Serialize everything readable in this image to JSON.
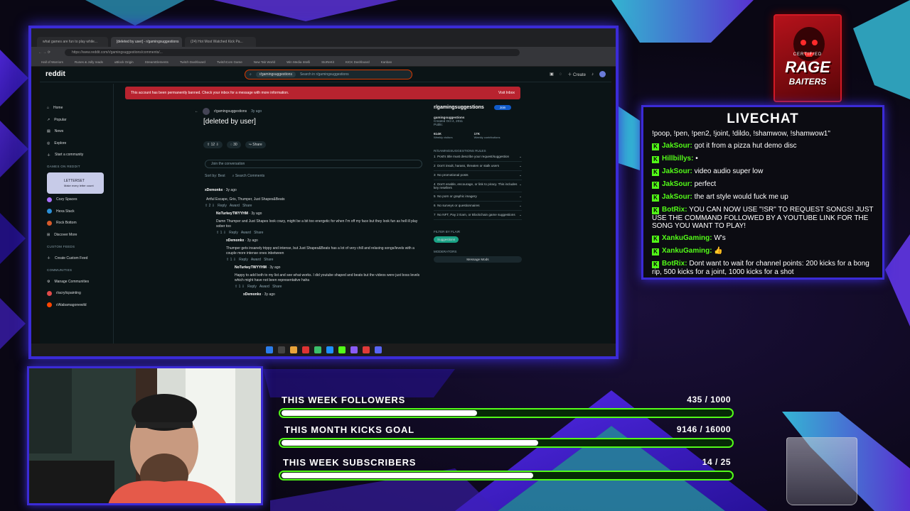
{
  "browser": {
    "tabs": [
      "what games are fun to play while...",
      "[deleted by user] - r/gamingsuggestions",
      "(24) Hot Most Watched Kick Pa..."
    ],
    "url": "https://www.reddit.com/r/gamingsuggestions/comments/...",
    "bookmarks": [
      "Hall of Warriors",
      "Runes & Jolly reads",
      "uBlock Origin",
      "StreamElements",
      "Twitch Dashboard",
      "TwitchCom Game",
      "New Tab World",
      "Win Media Intelli",
      "StoReKit",
      "KICK Dashboard",
      "Kanban"
    ]
  },
  "reddit": {
    "logo": "reddit",
    "search_chip": "r/gamingsuggestions",
    "search_placeholder": "Search in r/gamingsuggestions",
    "create_label": "Create",
    "ban_text": "This account has been permanently banned. Check your inbox for a message with more information.",
    "ban_action": "Visit Inbox",
    "nav": {
      "home": "Home",
      "popular": "Popular",
      "news": "News",
      "explore": "Explore",
      "start_community": "Start a community",
      "games_header": "GAMES ON REDDIT",
      "game_card_title": "LETTERSET",
      "game_card_sub": "Make every letter count",
      "games": [
        "Cozy Spaces",
        "Hexa Stack",
        "Rock Bottom"
      ],
      "discover": "Discover More",
      "custom_header": "CUSTOM FEEDS",
      "custom_feed": "Create Custom Feed",
      "communities_header": "COMMUNITIES",
      "manage": "Manage Communities",
      "comm1": "r/acrylicpainting",
      "comm2": "r/Alabamagonewild"
    },
    "post": {
      "sub": "r/gamingsuggestions",
      "age": "3y ago",
      "title": "[deleted by user]",
      "votes": "12",
      "comments": "30",
      "share": "Share",
      "join_placeholder": "Join the conversation",
      "sort_label": "Sort by:",
      "sort_value": "Best",
      "search_comments": "Search Comments"
    },
    "comments": [
      {
        "author": "xDemonkx",
        "age": "3y ago",
        "text": "Artful Escape, Gris, Thumper, Just Shapes&Beats",
        "votes": "2"
      },
      {
        "author": "NoTurkeyTWYYHM",
        "age": "3y ago",
        "text": "Damn Thumper and Just Shapes look crazy, might be a bit too energetic for when I'm off my face but they look fun as hell ill play sober too",
        "votes": "1"
      },
      {
        "author": "xDemonkx",
        "age": "3y ago",
        "text": "Thumper gets insanely trippy and intense, but Just Shapes&Beats has a lot of very chill and relaxing songs/levels with a couple more intense ones inbetween",
        "votes": "1"
      },
      {
        "author": "NoTurkeyTWYYHM",
        "age": "3y ago",
        "text": "Happy to add both to my list and see what works. I did youtube shaped and beats but the videos were just boss levels which might have not been representative haha",
        "votes": "1"
      },
      {
        "author": "xDemonkx",
        "age": "3y ago",
        "text": "",
        "votes": ""
      }
    ],
    "actions": {
      "reply": "Reply",
      "award": "Award",
      "share": "Share"
    },
    "sidebar": {
      "name": "r/gamingsuggestions",
      "join": "Join",
      "title": "gamingsuggestions",
      "created": "Created Oct 4, 2011",
      "public": "Public",
      "members": "614K",
      "members_label": "Weekly visitors",
      "contrib": "17K",
      "contrib_label": "Weekly contributions",
      "rules_header": "R/GAMINGSUGGESTIONS RULES",
      "rules": [
        "Post's title must describe your request/suggestion",
        "Don't insult, harass, threaten or stalk users",
        "No promotional posts",
        "Don't enable, encourage, or link to piracy. This includes key resellers",
        "No porn or graphic imagery",
        "No surveys or questionnaires",
        "No NFT, Pay 2 Earn, or Blockchain game suggestions"
      ],
      "flair_header": "FILTER BY FLAIR",
      "flair": "Suggestions",
      "mods_header": "MODERATORS",
      "message_mods": "Message Mods"
    }
  },
  "logo": {
    "line1": "CERTIFIED",
    "line2": "RAGE",
    "line3": "BAITERS"
  },
  "chat": {
    "title": "LIVECHAT",
    "messages": [
      {
        "user": "",
        "text": "!poop, !pen, !pen2, !joint, !dildo, !shamwow, !shamwow1\""
      },
      {
        "user": "JakSour:",
        "text": " got it from a pizza hut demo disc"
      },
      {
        "user": "Hillbillys:",
        "text": " •"
      },
      {
        "user": "JakSour:",
        "text": " video audio super low"
      },
      {
        "user": "JakSour:",
        "text": " perfect"
      },
      {
        "user": "JakSour:",
        "text": " the art style would fuck me up"
      },
      {
        "user": "BotRix:",
        "text": " YOU CAN NOW USE \"!SR\" TO REQUEST SONGS! JUST USE THE COMMAND FOLLOWED BY A YOUTUBE LINK FOR THE SONG YOU WANT TO PLAY!"
      },
      {
        "user": "XankuGaming:",
        "text": " W's"
      },
      {
        "user": "XankuGaming:",
        "text": " 👍"
      },
      {
        "user": "BotRix:",
        "text": " Dont want to wait for channel points: 200 kicks for a bong rip, 500 kicks for a joint, 1000 kicks for a shot"
      }
    ]
  },
  "goals": [
    {
      "label": "THIS WEEK FOLLOWERS",
      "value": "435 / 1000",
      "progress": 0.435
    },
    {
      "label": "THIS MONTH KICKS GOAL",
      "value": "9146 / 16000",
      "progress": 0.5716
    },
    {
      "label": "THIS WEEK SUBSCRIBERS",
      "value": "14 / 25",
      "progress": 0.56
    }
  ],
  "colors": {
    "accent": "#3b2bd6",
    "kick_green": "#53fc18",
    "reddit_bg": "#0b1416",
    "ban_red": "#b8232f"
  }
}
